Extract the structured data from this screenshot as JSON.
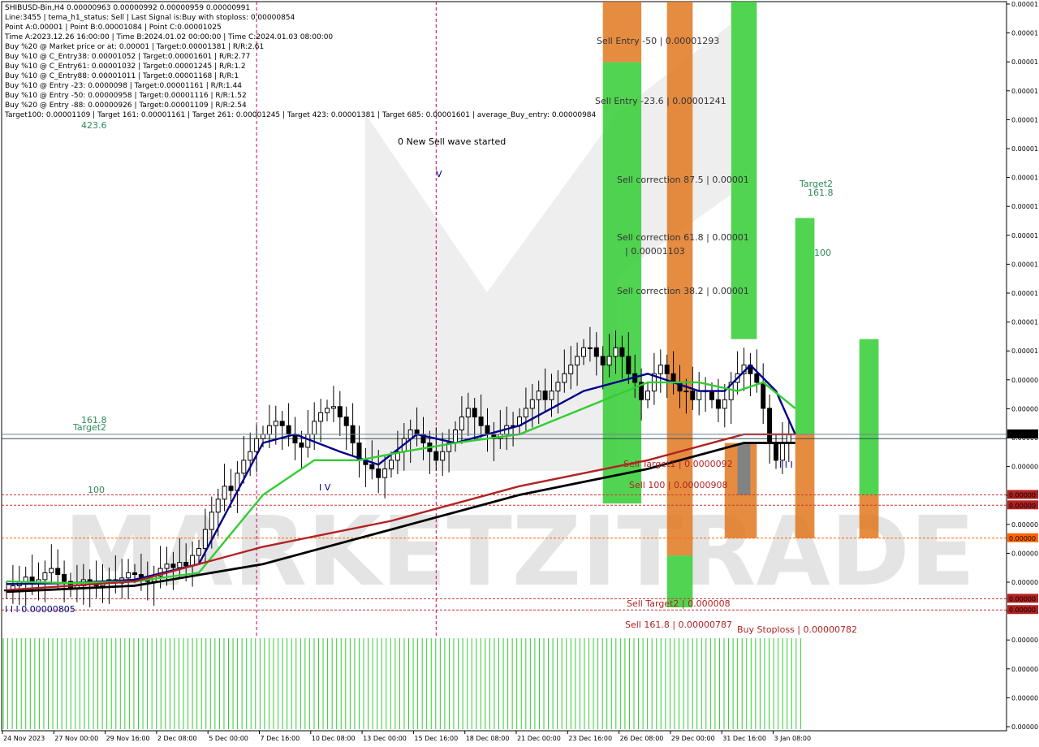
{
  "info_lines": [
    "SHIBUSD-Bin,H4  0.00000963 0.00000992 0.00000959 0.00000991",
    "Line:3455  |  tema_h1_status: Sell  |  Last Signal is:Buy with stoploss: 0.00000854",
    "Point A:0.00001  |  Point B:0.00001084  |  Point C:0.00001025",
    "Time A:2023.12.26 16:00:00  |  Time B:2024.01.02 00:00:00  |  Time C:2024.01.03 08:00:00",
    "Buy %20 @ Market price or at: 0.00001  |  Target:0.00001381  |  R/R:2.61",
    "Buy %10 @ C_Entry38: 0.00001052  |  Target:0.00001601  |  R/R:2.77",
    "Buy %10 @ C_Entry61: 0.00001032  |  Target:0.00001245  |  R/R:1.2",
    "Buy %10 @ C_Entry88: 0.00001011  |  Target:0.00001168  |  R/R:1",
    "Buy %10 @ Entry -23: 0.0000098  |  Target:0.00001161  |  R/R:1.44",
    "Buy %10 @ Entry -50: 0.00000958  |  Target:0.00001116  |  R/R:1.52",
    "Buy %20 @ Entry -88: 0.00000926  |  Target:0.00001109  |  R/R:2.54",
    "Target100: 0.00001109  |  Target 161: 0.00001161  |  Target 261: 0.00001245  |  Target 423: 0.00001381  |  Target 685: 0.00001601  |  average_Buy_entry: 0.00000984"
  ],
  "chart_data": {
    "type": "candlestick",
    "symbol": "SHIBUSD-Bin",
    "timeframe": "H4",
    "x_labels": [
      "24 Nov 2023",
      "27 Nov 00:00",
      "29 Nov 16:00",
      "2 Dec 08:00",
      "5 Dec 00:00",
      "7 Dec 16:00",
      "10 Dec 08:00",
      "13 Dec 00:00",
      "15 Dec 16:00",
      "18 Dec 08:00",
      "21 Dec 00:00",
      "23 Dec 16:00",
      "26 Dec 08:00",
      "29 Dec 00:00",
      "31 Dec 16:00",
      "3 Jan 08:00"
    ],
    "y_tick_labels": [
      "0.00001",
      "0.00001",
      "0.00001",
      "0.00001",
      "0.00001",
      "0.00001",
      "0.00001",
      "0.00001",
      "0.00001",
      "0.00001",
      "0.00001",
      "0.00001",
      "0.00001",
      "0.00000",
      "0.00000",
      "0.00000",
      "0.00000",
      "0.00000",
      "0.00000",
      "0.00000",
      "0.00000",
      "0.00000",
      "0.00000",
      "0.00000",
      "0.00000",
      "0.00000"
    ],
    "price_badges": [
      {
        "label": "0.00000",
        "color": "#000000",
        "text_color": "#ffffff"
      },
      {
        "label": "0.00000",
        "color": "#b22222",
        "text_color": "#ffffff"
      },
      {
        "label": "0.00000",
        "color": "#b22222",
        "text_color": "#ffffff"
      },
      {
        "label": "0.00000",
        "color": "#ff6600",
        "text_color": "#ffffff"
      },
      {
        "label": "0.00000",
        "color": "#b22222",
        "text_color": "#ffffff"
      },
      {
        "label": "0.00000",
        "color": "#b22222",
        "text_color": "#ffffff"
      }
    ],
    "candles_close": [
      8.1e-06,
      8.15e-06,
      8.2e-06,
      8.25e-06,
      8.18e-06,
      8.22e-06,
      8.3e-06,
      8.35e-06,
      8.28e-06,
      8.2e-06,
      8.12e-06,
      8.15e-06,
      8.22e-06,
      8.18e-06,
      8.15e-06,
      8.2e-06,
      8.22e-06,
      8.18e-06,
      8.24e-06,
      8.3e-06,
      8.28e-06,
      8.25e-06,
      8.2e-06,
      8.26e-06,
      8.35e-06,
      8.4e-06,
      8.36e-06,
      8.42e-06,
      8.38e-06,
      8.5e-06,
      8.58e-06,
      8.8e-06,
      9e-06,
      9.15e-06,
      9.3e-06,
      9.25e-06,
      9.45e-06,
      9.6e-06,
      9.7e-06,
      9.85e-06,
      9.9e-06,
      1e-05,
      1.005e-05,
      1e-05,
      9.9e-06,
      9.8e-06,
      9.75e-06,
      9.9e-06,
      1.005e-05,
      1.015e-05,
      1.02e-05,
      1.022e-05,
      1.01e-05,
      1e-05,
      9.8e-06,
      9.6e-06,
      9.55e-06,
      9.5e-06,
      9.4e-06,
      9.5e-06,
      9.6e-06,
      9.7e-06,
      9.85e-06,
      9.95e-06,
      9.9e-06,
      9.8e-06,
      9.7e-06,
      9.6e-06,
      9.7e-06,
      9.8e-06,
      9.95e-06,
      1.01e-05,
      1.02e-05,
      1.01e-05,
      1e-05,
      9.9e-06,
      9.85e-06,
      9.9e-06,
      1e-05,
      1e-05,
      1.01e-05,
      1.02e-05,
      1.03e-05,
      1.04e-05,
      1.03e-05,
      1.04e-05,
      1.05e-05,
      1.06e-05,
      1.07e-05,
      1.08e-05,
      1.09e-05,
      1.09e-05,
      1.08e-05,
      1.07e-05,
      1.08e-05,
      1.09e-05,
      1.08e-05,
      1.06e-05,
      1.05e-05,
      1.03e-05,
      1.04e-05,
      1.06e-05,
      1.07e-05,
      1.06e-05,
      1.05e-05,
      1.04e-05,
      1.04e-05,
      1.03e-05,
      1.04e-05,
      1.04e-05,
      1.03e-05,
      1.02e-05,
      1.03e-05,
      1.05e-05,
      1.06e-05,
      1.07e-05,
      1.06e-05,
      1.05e-05,
      1.02e-05,
      9.8e-06,
      9.6e-06,
      9.8e-06,
      9.9e-06
    ],
    "wicks_high_extra": 2e-07,
    "ma_series": [
      {
        "name": "blue",
        "color": "#00008b",
        "width": 2.4,
        "points": [
          [
            0,
            8.17e-06
          ],
          [
            10,
            8.18e-06
          ],
          [
            20,
            8.22e-06
          ],
          [
            30,
            8.4e-06
          ],
          [
            40,
            9.8e-06
          ],
          [
            45,
            9.9e-06
          ],
          [
            52,
            9.7e-06
          ],
          [
            58,
            9.55e-06
          ],
          [
            64,
            9.9e-06
          ],
          [
            70,
            9.8e-06
          ],
          [
            80,
            1e-05
          ],
          [
            90,
            1.04e-05
          ],
          [
            100,
            1.06e-05
          ],
          [
            108,
            1.04e-05
          ],
          [
            112,
            1.04e-05
          ],
          [
            116,
            1.07e-05
          ],
          [
            120,
            1.04e-05
          ],
          [
            123,
            9.9e-06
          ]
        ]
      },
      {
        "name": "green",
        "color": "#32cd32",
        "width": 2.4,
        "points": [
          [
            0,
            8.2e-06
          ],
          [
            10,
            8.18e-06
          ],
          [
            20,
            8.2e-06
          ],
          [
            30,
            8.3e-06
          ],
          [
            40,
            9.2e-06
          ],
          [
            48,
            9.6e-06
          ],
          [
            55,
            9.6e-06
          ],
          [
            62,
            9.7e-06
          ],
          [
            70,
            9.8e-06
          ],
          [
            80,
            9.9e-06
          ],
          [
            90,
            1.02e-05
          ],
          [
            100,
            1.05e-05
          ],
          [
            108,
            1.05e-05
          ],
          [
            114,
            1.04e-05
          ],
          [
            118,
            1.05e-05
          ],
          [
            123,
            1.02e-05
          ]
        ]
      },
      {
        "name": "darkred",
        "color": "#b22222",
        "width": 2.4,
        "points": [
          [
            0,
            8.1e-06
          ],
          [
            20,
            8.2e-06
          ],
          [
            40,
            8.6e-06
          ],
          [
            60,
            8.9e-06
          ],
          [
            80,
            9.3e-06
          ],
          [
            100,
            9.6e-06
          ],
          [
            115,
            9.9e-06
          ],
          [
            123,
            9.9e-06
          ]
        ]
      },
      {
        "name": "black",
        "color": "#000000",
        "width": 2.8,
        "points": [
          [
            0,
            8.08e-06
          ],
          [
            20,
            8.15e-06
          ],
          [
            40,
            8.4e-06
          ],
          [
            60,
            8.8e-06
          ],
          [
            80,
            9.2e-06
          ],
          [
            100,
            9.5e-06
          ],
          [
            115,
            9.8e-06
          ],
          [
            123,
            9.8e-06
          ]
        ]
      }
    ],
    "vertical_markers": [
      {
        "x_index": 39,
        "color": "#cc0066"
      },
      {
        "x_index": 67,
        "color": "#cc0066"
      }
    ],
    "horizontal_lines": [
      {
        "price": 9.2e-06,
        "color": "#cc3333",
        "style": "dotted"
      },
      {
        "price": 9.08e-06,
        "color": "#cc3333",
        "style": "dotted"
      },
      {
        "price": 8.7e-06,
        "color": "#ff6600",
        "style": "dotted"
      },
      {
        "price": 8e-06,
        "color": "#cc3333",
        "style": "dotted"
      },
      {
        "price": 7.87e-06,
        "color": "#cc3333",
        "style": "dotted"
      },
      {
        "price": 9.85e-06,
        "color": "#2f4f4f",
        "style": "solid"
      }
    ],
    "bands": [
      {
        "x0_index": 93,
        "x1_index": 99,
        "y0": 1.49e-05,
        "y1": 1.42e-05,
        "color": "#e07820"
      },
      {
        "x0_index": 93,
        "x1_index": 99,
        "y0": 1.42e-05,
        "y1": 9.1e-06,
        "color": "#33cc33"
      },
      {
        "x0_index": 103,
        "x1_index": 107,
        "y0": 1.49e-05,
        "y1": 8.5e-06,
        "color": "#e07820"
      },
      {
        "x0_index": 103,
        "x1_index": 107,
        "y0": 8.5e-06,
        "y1": 7.9e-06,
        "color": "#33cc33"
      },
      {
        "x0_index": 113,
        "x1_index": 117,
        "y0": 1.49e-05,
        "y1": 1.1e-05,
        "color": "#33cc33"
      },
      {
        "x0_index": 112,
        "x1_index": 117,
        "y0": 9.8e-06,
        "y1": 8.7e-06,
        "color": "#e07820"
      },
      {
        "x0_index": 114,
        "x1_index": 116,
        "y0": 9.8e-06,
        "y1": 9.2e-06,
        "color": "#708090"
      },
      {
        "x0_index": 123,
        "x1_index": 126,
        "y0": 1.24e-05,
        "y1": 9.9e-06,
        "color": "#33cc33"
      },
      {
        "x0_index": 123,
        "x1_index": 126,
        "y0": 9.9e-06,
        "y1": 8.7e-06,
        "color": "#e07820"
      },
      {
        "x0_index": 133,
        "x1_index": 136,
        "y0": 1.1e-05,
        "y1": 9.2e-06,
        "color": "#33cc33"
      },
      {
        "x0_index": 133,
        "x1_index": 136,
        "y0": 9.2e-06,
        "y1": 8.7e-06,
        "color": "#e07820"
      }
    ],
    "price_range": {
      "top": 1.49e-05,
      "bottom": 7.6e-06
    },
    "histogram_color": "#33cc33",
    "annotations": [
      {
        "text": "423.6",
        "color": "#2e8b57",
        "anchor": "top-left"
      },
      {
        "text": "0 New Sell wave started",
        "color": "#000000",
        "anchor": "top-center"
      },
      {
        "text": "Sell Entry -50 | 0.00001293",
        "color": "#333333",
        "anchor": "right-top"
      },
      {
        "text": "Sell Entry -23.6 | 0.00001241",
        "color": "#333333",
        "anchor": "right-top"
      },
      {
        "text": "Sell correction 87.5 | 0.00001",
        "color": "#333333",
        "anchor": "right"
      },
      {
        "text": "Sell correction 61.8 | 0.00001",
        "color": "#333333",
        "anchor": "right"
      },
      {
        "text": "| 0.00001103",
        "color": "#333333",
        "anchor": "right"
      },
      {
        "text": "Sell correction 38.2 | 0.00001",
        "color": "#333333",
        "anchor": "right"
      },
      {
        "text": "Target2",
        "color": "#2e8b57",
        "anchor": "right"
      },
      {
        "text": "161.8",
        "color": "#2e8b57",
        "anchor": "right"
      },
      {
        "text": "100",
        "color": "#2e8b57",
        "anchor": "right"
      },
      {
        "text": "161.8",
        "color": "#2e8b57",
        "anchor": "left"
      },
      {
        "text": "Target2",
        "color": "#2e8b57",
        "anchor": "left"
      },
      {
        "text": "100",
        "color": "#2e8b57",
        "anchor": "left"
      },
      {
        "text": "Sell Target1 | 0.0000092",
        "color": "#b22222",
        "anchor": "right"
      },
      {
        "text": "Sell 100 | 0.00000908",
        "color": "#b22222",
        "anchor": "right"
      },
      {
        "text": "Sell Target2 | 0.000008",
        "color": "#b22222",
        "anchor": "right"
      },
      {
        "text": "Sell 161.8 | 0.00000787",
        "color": "#b22222",
        "anchor": "right"
      },
      {
        "text": "Buy Stoploss | 0.00000782",
        "color": "#b22222",
        "anchor": "right"
      },
      {
        "text": "I I I 0.00000805",
        "color": "#00008b",
        "anchor": "left"
      },
      {
        "text": "I V",
        "color": "#00008b",
        "anchor": "center"
      },
      {
        "text": "I I I",
        "color": "#00008b",
        "anchor": "right"
      },
      {
        "text": "V",
        "color": "#00008b",
        "anchor": "center"
      }
    ],
    "watermark": "MARKETZITRADE"
  }
}
